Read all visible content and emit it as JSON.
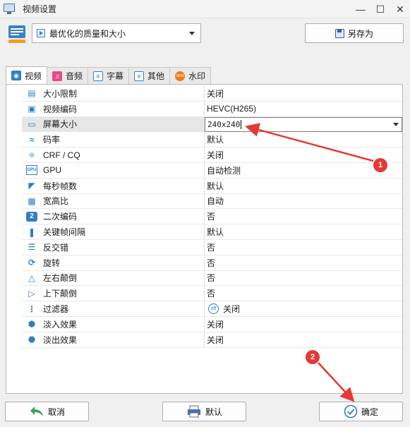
{
  "window": {
    "title": "视频设置"
  },
  "preset": {
    "selected": "最优化的质量和大小",
    "save_as_label": "另存为"
  },
  "tabs": [
    {
      "label": "视频",
      "icon": "video-icon",
      "active": true
    },
    {
      "label": "音频",
      "icon": "music-icon",
      "active": false
    },
    {
      "label": "字幕",
      "icon": "subtitle-icon",
      "active": false
    },
    {
      "label": "其他",
      "icon": "settings-sliders-icon",
      "active": false
    },
    {
      "label": "水印",
      "icon": "new-badge-icon",
      "active": false
    }
  ],
  "settings": [
    {
      "name": "大小限制",
      "value": "关闭",
      "icon": "ruler-icon"
    },
    {
      "name": "视频编码",
      "value": "HEVC(H265)",
      "icon": "chip-icon"
    },
    {
      "name": "屏幕大小",
      "value": "240x240",
      "icon": "screen-icon",
      "selected": true
    },
    {
      "name": "码率",
      "value": "默认",
      "icon": "waves-icon"
    },
    {
      "name": "CRF / CQ",
      "value": "关闭",
      "icon": "atom-icon"
    },
    {
      "name": "GPU",
      "value": "自动检测",
      "icon": "gpu-icon"
    },
    {
      "name": "每秒帧数",
      "value": "默认",
      "icon": "speed-icon"
    },
    {
      "name": "宽高比",
      "value": "自动",
      "icon": "aspect-icon"
    },
    {
      "name": "二次编码",
      "value": "否",
      "icon": "two-pass-icon"
    },
    {
      "name": "关键帧间隔",
      "value": "默认",
      "icon": "keyframe-icon"
    },
    {
      "name": "反交错",
      "value": "否",
      "icon": "deinterlace-icon"
    },
    {
      "name": "旋转",
      "value": "否",
      "icon": "rotate-icon"
    },
    {
      "name": "左右颠倒",
      "value": "否",
      "icon": "flip-horizontal-icon"
    },
    {
      "name": "上下颠倒",
      "value": "否",
      "icon": "flip-vertical-icon"
    },
    {
      "name": "过滤器",
      "value": "关闭",
      "icon": "filter-icon",
      "off_badge": "off"
    },
    {
      "name": "淡入效果",
      "value": "关闭",
      "icon": "fade-in-icon"
    },
    {
      "name": "淡出效果",
      "value": "关闭",
      "icon": "fade-out-icon"
    }
  ],
  "buttons": {
    "cancel": "取消",
    "default": "默认",
    "ok": "确定"
  },
  "annotations": {
    "marker_1": "1",
    "marker_2": "2"
  },
  "colors": {
    "accent": "#2f7fc4",
    "annotation": "#e53935"
  }
}
